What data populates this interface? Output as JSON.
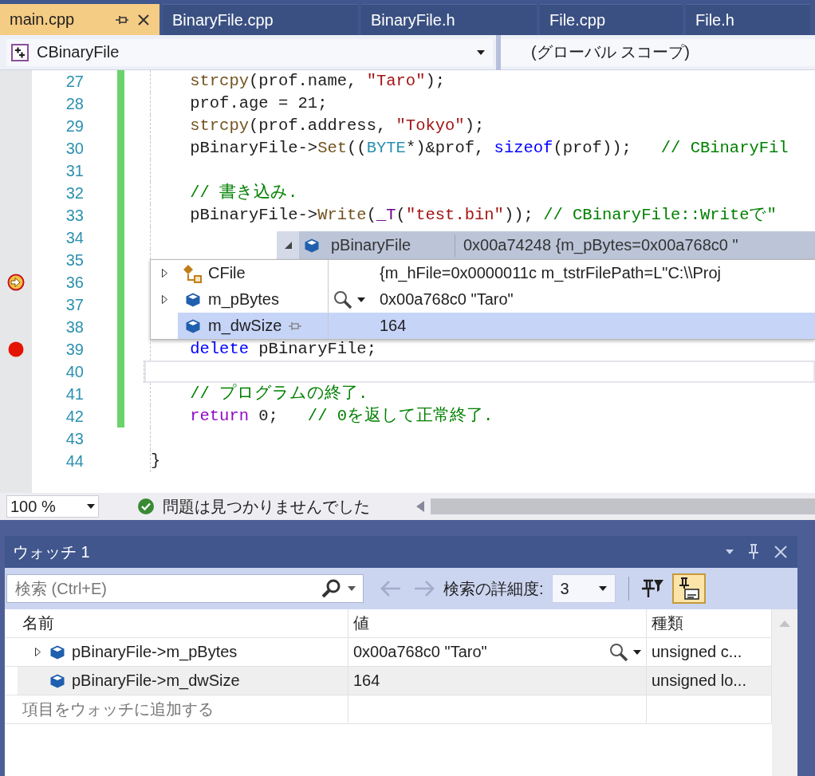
{
  "tabs": [
    {
      "label": "main.cpp",
      "selected": true
    },
    {
      "label": "BinaryFile.cpp",
      "selected": false
    },
    {
      "label": "BinaryFile.h",
      "selected": false
    },
    {
      "label": "File.cpp",
      "selected": false
    },
    {
      "label": "File.h",
      "selected": false
    }
  ],
  "navigation_bar": {
    "type_scope": "CBinaryFile",
    "global_scope": "(グローバル スコープ)"
  },
  "editor": {
    "lines": [
      {
        "number": "27",
        "breakpoint": false,
        "current": false,
        "changed": true,
        "highlighted": false,
        "indented": true,
        "tokens": [
          {
            "kind": "function",
            "text": "strcpy"
          },
          {
            "kind": "plain",
            "text": "(prof.name, "
          },
          {
            "kind": "string",
            "text": "\"Taro\""
          },
          {
            "kind": "plain",
            "text": ");"
          }
        ]
      },
      {
        "number": "28",
        "breakpoint": false,
        "current": false,
        "changed": true,
        "highlighted": false,
        "indented": true,
        "tokens": [
          {
            "kind": "plain",
            "text": "prof.age = 21;"
          }
        ]
      },
      {
        "number": "29",
        "breakpoint": false,
        "current": false,
        "changed": true,
        "highlighted": false,
        "indented": true,
        "tokens": [
          {
            "kind": "function",
            "text": "strcpy"
          },
          {
            "kind": "plain",
            "text": "(prof.address, "
          },
          {
            "kind": "string",
            "text": "\"Tokyo\""
          },
          {
            "kind": "plain",
            "text": ");"
          }
        ]
      },
      {
        "number": "30",
        "breakpoint": false,
        "current": false,
        "changed": true,
        "highlighted": false,
        "indented": true,
        "tokens": [
          {
            "kind": "plain",
            "text": "pBinaryFile->"
          },
          {
            "kind": "function",
            "text": "Set"
          },
          {
            "kind": "plain",
            "text": "(("
          },
          {
            "kind": "type",
            "text": "BYTE"
          },
          {
            "kind": "plain",
            "text": "*)&prof, "
          },
          {
            "kind": "keyword",
            "text": "sizeof"
          },
          {
            "kind": "plain",
            "text": "(prof));   "
          },
          {
            "kind": "comment",
            "text": "// CBinaryFil"
          }
        ]
      },
      {
        "number": "31",
        "breakpoint": false,
        "current": false,
        "changed": true,
        "highlighted": false
      },
      {
        "number": "32",
        "breakpoint": false,
        "current": false,
        "changed": true,
        "highlighted": false,
        "indented": true,
        "tokens": [
          {
            "kind": "comment",
            "text": "// 書き込み."
          }
        ]
      },
      {
        "number": "33",
        "breakpoint": false,
        "current": false,
        "changed": true,
        "highlighted": false,
        "indented": true,
        "tokens": [
          {
            "kind": "plain",
            "text": "pBinaryFile->"
          },
          {
            "kind": "function",
            "text": "Write"
          },
          {
            "kind": "plain",
            "text": "("
          },
          {
            "kind": "macro",
            "text": "_T"
          },
          {
            "kind": "plain",
            "text": "("
          },
          {
            "kind": "string",
            "text": "\"test.bin\""
          },
          {
            "kind": "plain",
            "text": ")); "
          },
          {
            "kind": "comment",
            "text": "// CBinaryFile::Writeで\""
          }
        ]
      },
      {
        "number": "34",
        "breakpoint": false,
        "current": false,
        "changed": true,
        "highlighted": false
      },
      {
        "number": "35",
        "breakpoint": false,
        "current": false,
        "changed": true,
        "highlighted": false
      },
      {
        "number": "36",
        "breakpoint": true,
        "current": true,
        "changed": true,
        "highlighted": false
      },
      {
        "number": "37",
        "breakpoint": false,
        "current": false,
        "changed": true,
        "highlighted": false
      },
      {
        "number": "38",
        "breakpoint": false,
        "current": false,
        "changed": true,
        "highlighted": false
      },
      {
        "number": "39",
        "breakpoint": true,
        "current": false,
        "changed": true,
        "highlighted": false,
        "indented": true,
        "tokens": [
          {
            "kind": "keyword",
            "text": "delete"
          },
          {
            "kind": "plain",
            "text": " pBinaryFile;"
          }
        ]
      },
      {
        "number": "40",
        "breakpoint": false,
        "current": false,
        "changed": true,
        "highlighted": true
      },
      {
        "number": "41",
        "breakpoint": false,
        "current": false,
        "changed": true,
        "highlighted": false,
        "indented": true,
        "tokens": [
          {
            "kind": "comment",
            "text": "// プログラムの終了."
          }
        ]
      },
      {
        "number": "42",
        "breakpoint": false,
        "current": false,
        "changed": true,
        "highlighted": false,
        "indented": true,
        "tokens": [
          {
            "kind": "control",
            "text": "return"
          },
          {
            "kind": "plain",
            "text": " 0;   "
          },
          {
            "kind": "comment",
            "text": "// 0を返して正常終了."
          }
        ]
      },
      {
        "number": "43",
        "breakpoint": false,
        "current": false,
        "changed": false,
        "highlighted": false
      },
      {
        "number": "44",
        "breakpoint": false,
        "current": false,
        "changed": false,
        "highlighted": false,
        "indented": false,
        "tokens": [
          {
            "kind": "plain",
            "text": "}"
          }
        ]
      }
    ]
  },
  "datatip": {
    "expression": "pBinaryFile",
    "value": "0x00a74248 {m_pBytes=0x00a768c0 \"",
    "expanded": true,
    "members": [
      {
        "name": "CFile",
        "kind": "base",
        "value": "{m_hFile=0x0000011c m_tstrFilePath=L\"C:\\\\Proj",
        "expandable": true,
        "visualizer": false,
        "selected": false
      },
      {
        "name": "m_pBytes",
        "kind": "field",
        "value": "0x00a768c0 \"Taro\"",
        "expandable": true,
        "visualizer": true,
        "selected": false
      },
      {
        "name": "m_dwSize",
        "kind": "field",
        "value": "164",
        "expandable": false,
        "visualizer": false,
        "selected": true
      }
    ]
  },
  "status_bar": {
    "zoom": "100 %",
    "issues": "問題は見つかりませんでした"
  },
  "watch": {
    "title": "ウォッチ 1",
    "search": {
      "placeholder": "検索 (Ctrl+E)"
    },
    "back_disabled": true,
    "forward_disabled": true,
    "depth_label": "検索の詳細度:",
    "depth": "3",
    "display_toggle_pressed": true,
    "columns": [
      "名前",
      "値",
      "種類"
    ],
    "rows": [
      {
        "name": "pBinaryFile->m_pBytes",
        "value": "0x00a768c0 \"Taro\"",
        "type": "unsigned c...",
        "expandable": true,
        "visualizer": true,
        "selected": false
      },
      {
        "name": "pBinaryFile->m_dwSize",
        "value": "164",
        "type": "unsigned lo...",
        "expandable": false,
        "visualizer": false,
        "selected": true
      }
    ],
    "add_placeholder": "項目をウォッチに追加する"
  }
}
